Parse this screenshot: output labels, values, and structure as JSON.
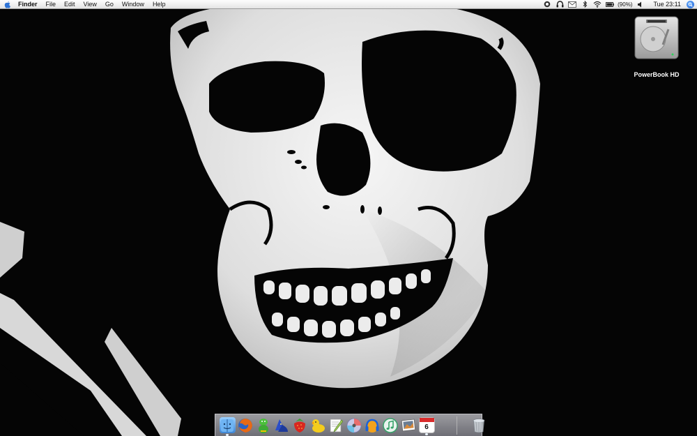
{
  "menubar": {
    "app_name": "Finder",
    "menus": [
      "File",
      "Edit",
      "View",
      "Go",
      "Window",
      "Help"
    ],
    "battery_text": "(90%)",
    "clock": "Tue 23:11"
  },
  "desktop": {
    "icons": [
      {
        "label": "PowerBook HD",
        "icon": "hard-drive-icon"
      }
    ]
  },
  "dock": {
    "apps": [
      {
        "name": "finder",
        "icon": "finder-icon",
        "color": "#5fa6e8",
        "running": true
      },
      {
        "name": "firefox",
        "icon": "firefox-icon",
        "color": "#e76a16",
        "running": false
      },
      {
        "name": "adium",
        "icon": "adium-icon",
        "color": "#3faa34",
        "running": false
      },
      {
        "name": "wizard",
        "icon": "wizard-icon",
        "color": "#2a4ec9",
        "running": false
      },
      {
        "name": "strawberry",
        "icon": "strawberry-icon",
        "color": "#d9271f",
        "running": false
      },
      {
        "name": "cyberduck",
        "icon": "duck-icon",
        "color": "#f4cc1c",
        "running": false
      },
      {
        "name": "textedit",
        "icon": "textedit-icon",
        "color": "#9ec65a",
        "running": false
      },
      {
        "name": "itunes-cd",
        "icon": "cd-icon",
        "color": "#b8b8d8",
        "running": false
      },
      {
        "name": "audio",
        "icon": "headphones-icon",
        "color": "#1d63d9",
        "running": false
      },
      {
        "name": "itunes",
        "icon": "itunes-icon",
        "color": "#38a36a",
        "running": false
      },
      {
        "name": "iphoto",
        "icon": "iphoto-icon",
        "color": "#6b7d93",
        "running": false
      },
      {
        "name": "ical",
        "icon": "calendar-icon",
        "color": "#ffffff",
        "running": true,
        "badge_text": "6"
      }
    ],
    "trash_icon": "trash-icon"
  }
}
